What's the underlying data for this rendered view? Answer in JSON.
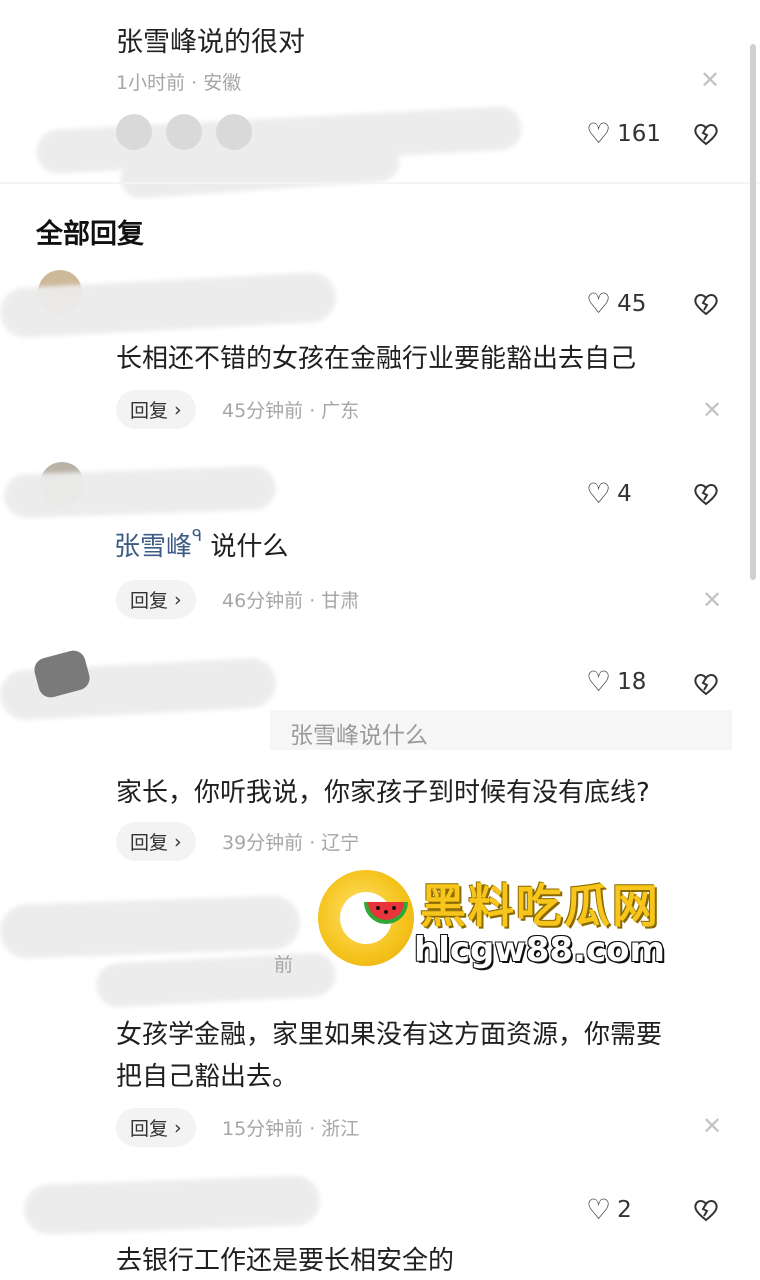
{
  "top_comment": {
    "text": "张雪峰说的很对",
    "meta": "1小时前 · 安徽",
    "likes": "161"
  },
  "section_title": "全部回复",
  "replies": [
    {
      "likes": "45",
      "text": "长相还不错的女孩在金融行业要能豁出去自己",
      "reply_label": "回复",
      "meta": "45分钟前 · 广东"
    },
    {
      "likes": "4",
      "mention": "张雪峰",
      "mention_icon": "ᑫ",
      "text": "说什么",
      "reply_label": "回复",
      "meta": "46分钟前 · 甘肃"
    },
    {
      "likes": "18",
      "quote": "张雪峰说什么",
      "text": "家长，你听我说，你家孩子到时候有没有底线?",
      "reply_label": "回复",
      "meta": "39分钟前 · 辽宁"
    },
    {
      "partial_meta": "前",
      "text_line1": "女孩学金融，家里如果没有这方面资源，你需要",
      "text_line2": "把自己豁出去。",
      "reply_label": "回复",
      "meta": "15分钟前 · 浙江"
    },
    {
      "likes": "2",
      "text": "去银行工作还是要长相安全的"
    }
  ],
  "watermark": {
    "title": "黑料吃瓜网",
    "url": "hlcgw88.com"
  },
  "icons": {
    "like": "heart-outline-icon",
    "dislike": "broken-heart-icon",
    "close": "close-icon",
    "chevron": "chevron-right-icon"
  }
}
